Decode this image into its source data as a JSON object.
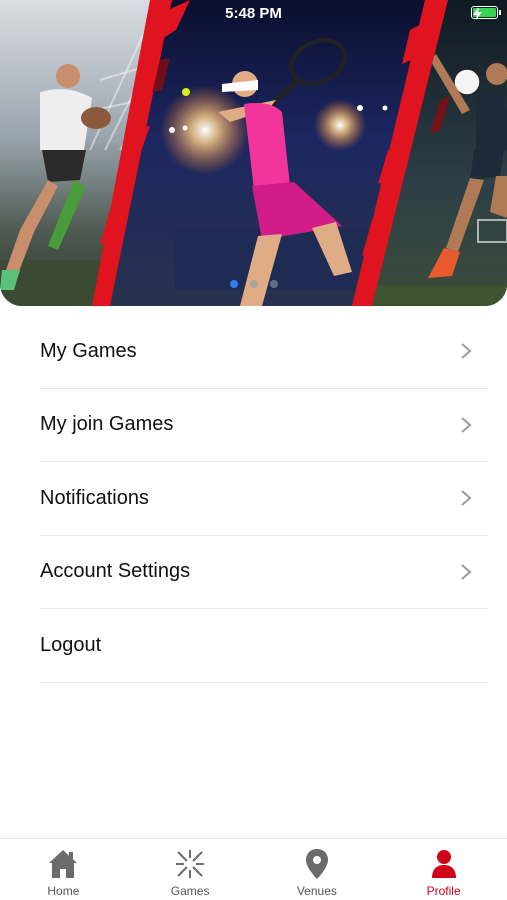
{
  "status_bar": {
    "time": "5:48 PM",
    "battery_level": 1.0
  },
  "hero": {
    "carousel_page": 1,
    "carousel_count": 3,
    "colors": {
      "accent_red": "#e0141e",
      "active_dot": "#2f7cf6",
      "inactive_dot": "#8e9bb0"
    }
  },
  "menu": {
    "items": [
      {
        "label": "My Games",
        "has_chevron": true
      },
      {
        "label": "My join Games",
        "has_chevron": true
      },
      {
        "label": "Notifications",
        "has_chevron": true
      },
      {
        "label": "Account Settings",
        "has_chevron": true
      },
      {
        "label": "Logout",
        "has_chevron": false
      }
    ]
  },
  "tabbar": {
    "tabs": [
      {
        "label": "Home",
        "icon": "home-icon",
        "active": false
      },
      {
        "label": "Games",
        "icon": "games-icon",
        "active": false
      },
      {
        "label": "Venues",
        "icon": "map-pin-icon",
        "active": false
      },
      {
        "label": "Profile",
        "icon": "person-icon",
        "active": true
      }
    ],
    "colors": {
      "active": "#d0021b",
      "inactive": "#555555"
    }
  }
}
